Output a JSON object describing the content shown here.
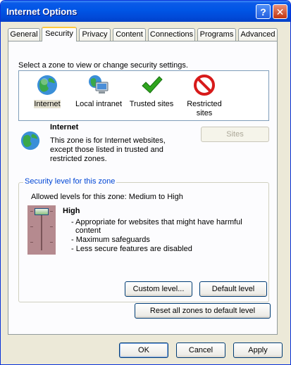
{
  "window": {
    "title": "Internet Options"
  },
  "tabs": [
    {
      "label": "General"
    },
    {
      "label": "Security"
    },
    {
      "label": "Privacy"
    },
    {
      "label": "Content"
    },
    {
      "label": "Connections"
    },
    {
      "label": "Programs"
    },
    {
      "label": "Advanced"
    }
  ],
  "selected_tab": "Security",
  "security": {
    "instruction": "Select a zone to view or change security settings.",
    "zones": [
      {
        "label": "Internet",
        "icon": "globe-icon",
        "selected": true
      },
      {
        "label": "Local intranet",
        "icon": "intranet-icon"
      },
      {
        "label": "Trusted sites",
        "icon": "checkmark-icon"
      },
      {
        "label": "Restricted",
        "label2": "sites",
        "icon": "restricted-icon"
      }
    ],
    "zone_name": "Internet",
    "zone_desc": [
      "This zone is for Internet websites,",
      "except those listed in trusted and",
      "restricted zones."
    ],
    "sites_button": "Sites",
    "level_group": {
      "legend": "Security level for this zone",
      "allowed": "Allowed levels for this zone: Medium to High",
      "level_name": "High",
      "bullets": [
        "- Appropriate for websites that might have harmful",
        "content",
        "- Maximum safeguards",
        "- Less secure features are disabled"
      ],
      "custom_button": "Custom level...",
      "default_button": "Default level"
    },
    "reset_button": "Reset all zones to default level"
  },
  "footer": {
    "ok": "OK",
    "cancel": "Cancel",
    "apply": "Apply"
  },
  "colors": {
    "title_bar": "#0055e5",
    "dialog_bg": "#ece9d8",
    "panel_bg": "#fcfcfe",
    "legend": "#0046d5",
    "slider_bg": "#b58a8f"
  }
}
